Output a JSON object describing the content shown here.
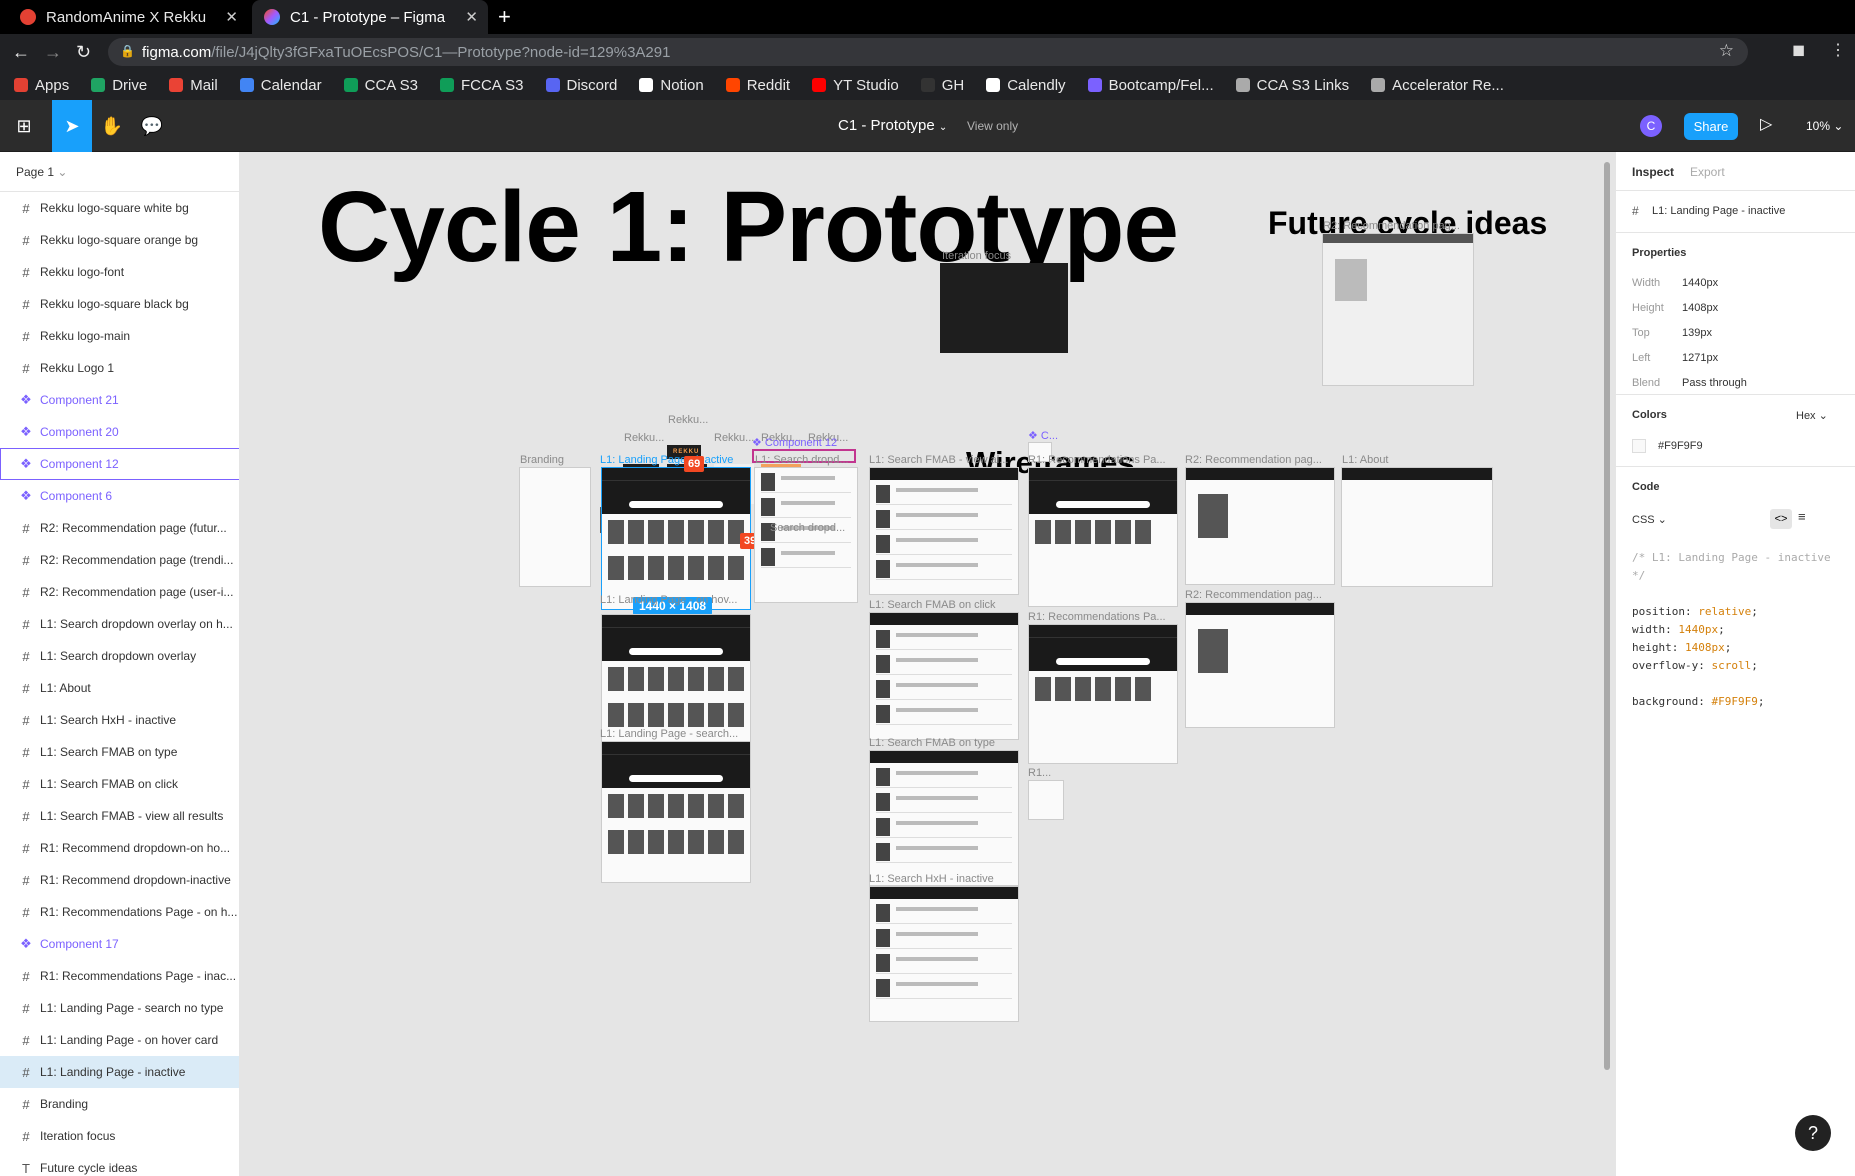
{
  "browser": {
    "tabs": [
      {
        "title": "RandomAnime X Rekku",
        "close": "✕"
      },
      {
        "title": "C1 - Prototype – Figma",
        "close": "✕"
      }
    ],
    "new_tab": "+",
    "url_host": "figma.com",
    "url_path": "/file/J4jQlty3fGFxaTuOEcsPOS/C1—Prototype?node-id=129%3A291",
    "bookmarks": [
      {
        "label": "Apps",
        "color": "#e34133"
      },
      {
        "label": "Drive",
        "color": "#1fa463"
      },
      {
        "label": "Mail",
        "color": "#ea4335"
      },
      {
        "label": "Calendar",
        "color": "#4285f4"
      },
      {
        "label": "CCA S3",
        "color": "#0f9d58"
      },
      {
        "label": "FCCA S3",
        "color": "#0f9d58"
      },
      {
        "label": "Discord",
        "color": "#5865f2"
      },
      {
        "label": "Notion",
        "color": "#ffffff"
      },
      {
        "label": "Reddit",
        "color": "#ff4500"
      },
      {
        "label": "YT Studio",
        "color": "#ff0000"
      },
      {
        "label": "GH",
        "color": "#333333"
      },
      {
        "label": "Calendly",
        "color": "#ffffff"
      },
      {
        "label": "Bootcamp/Fel...",
        "color": "#7b61ff"
      },
      {
        "label": "CCA S3 Links",
        "color": "#aaaaaa"
      },
      {
        "label": "Accelerator Re...",
        "color": "#aaaaaa"
      }
    ]
  },
  "figma": {
    "file_title": "C1 - Prototype",
    "view_mode": "View only",
    "avatar_letter": "C",
    "share_label": "Share",
    "zoom": "10%",
    "page_selector": "Page 1",
    "layers": [
      {
        "name": "Rekku logo-square white bg",
        "type": "frame"
      },
      {
        "name": "Rekku logo-square orange bg",
        "type": "frame"
      },
      {
        "name": "Rekku logo-font",
        "type": "frame"
      },
      {
        "name": "Rekku logo-square black bg",
        "type": "frame"
      },
      {
        "name": "Rekku logo-main",
        "type": "frame"
      },
      {
        "name": "Rekku Logo 1",
        "type": "frame"
      },
      {
        "name": "Component 21",
        "type": "component"
      },
      {
        "name": "Component 20",
        "type": "component"
      },
      {
        "name": "Component 12",
        "type": "component"
      },
      {
        "name": "Component 6",
        "type": "component"
      },
      {
        "name": "R2: Recommendation page (futur...",
        "type": "frame"
      },
      {
        "name": "R2: Recommendation page (trendi...",
        "type": "frame"
      },
      {
        "name": "R2: Recommendation page (user-i...",
        "type": "frame"
      },
      {
        "name": "L1: Search dropdown overlay on h...",
        "type": "frame"
      },
      {
        "name": "L1: Search dropdown overlay",
        "type": "frame"
      },
      {
        "name": "L1: About",
        "type": "frame"
      },
      {
        "name": "L1: Search HxH - inactive",
        "type": "frame"
      },
      {
        "name": "L1: Search FMAB on type",
        "type": "frame"
      },
      {
        "name": "L1: Search FMAB on click",
        "type": "frame"
      },
      {
        "name": "L1: Search FMAB - view all results",
        "type": "frame"
      },
      {
        "name": "R1: Recommend dropdown-on ho...",
        "type": "frame"
      },
      {
        "name": "R1: Recommend dropdown-inactive",
        "type": "frame"
      },
      {
        "name": "R1: Recommendations Page - on h...",
        "type": "frame"
      },
      {
        "name": "Component 17",
        "type": "component"
      },
      {
        "name": "R1: Recommendations Page - inac...",
        "type": "frame"
      },
      {
        "name": "L1: Landing Page - search no type",
        "type": "frame"
      },
      {
        "name": "L1: Landing Page - on hover card",
        "type": "frame"
      },
      {
        "name": "L1: Landing Page - inactive",
        "type": "frame"
      },
      {
        "name": "Branding",
        "type": "frame"
      },
      {
        "name": "Iteration focus",
        "type": "frame"
      },
      {
        "name": "Future cycle ideas",
        "type": "text"
      }
    ],
    "canvas": {
      "main_title": "Cycle 1: Prototype",
      "future_title": "Future cycle ideas",
      "wireframes_title": "Wireframes",
      "labels": {
        "iteration_focus": "Iteration focus",
        "r2_future": "R2: Recommendation pag...",
        "branding": "Branding",
        "landing_inactive": "L1: Landing Page - inactive",
        "component12": "Component 12",
        "search_dropdown": "L1: Search dropd...",
        "search_dropdown_overlay": "Search dropd...",
        "fmab_view_all": "L1: Search FMAB - view al...",
        "r1_recs": "R1: Recommendations Pa...",
        "r2_rec": "R2: Recommendation pag...",
        "about": "L1: About",
        "landing_hover": "L1: Landing Page - on hov...",
        "fmab_click": "L1: Search FMAB on click",
        "r1_recs2": "R1: Recommendations Pa...",
        "r2_rec2": "R2: Recommendation pag...",
        "landing_search": "L1: Landing Page - search...",
        "fmab_type": "L1: Search FMAB on type",
        "hxh_inactive": "L1: Search HxH - inactive",
        "rekku": "Rekku...",
        "comp_c": "C...",
        "r1_small": "R1..."
      },
      "logo_word": "REKKU",
      "badge_69": "69",
      "badge_39": "39",
      "dimension_badge": "1440 × 1408"
    },
    "inspect": {
      "tab_inspect": "Inspect",
      "tab_export": "Export",
      "selected_name": "L1: Landing Page - inactive",
      "properties_title": "Properties",
      "props": [
        {
          "key": "Width",
          "value": "1440px"
        },
        {
          "key": "Height",
          "value": "1408px"
        },
        {
          "key": "Top",
          "value": "139px"
        },
        {
          "key": "Left",
          "value": "1271px"
        },
        {
          "key": "Blend",
          "value": "Pass through"
        }
      ],
      "colors_title": "Colors",
      "color_format": "Hex",
      "color_value": "#F9F9F9",
      "code_title": "Code",
      "code_lang": "CSS",
      "code_comment1": "/* L1: Landing Page - inactive",
      "code_comment2": "*/",
      "code_lines": [
        {
          "prop": "position: ",
          "val": "relative",
          "end": ";"
        },
        {
          "prop": "width: ",
          "val": "1440px",
          "end": ";"
        },
        {
          "prop": "height: ",
          "val": "1408px",
          "end": ";"
        },
        {
          "prop": "overflow-y: ",
          "val": "scroll",
          "end": ";"
        }
      ],
      "code_bg_prop": "background: ",
      "code_bg_val": "#F9F9F9",
      "code_bg_end": ";"
    },
    "help": "?"
  }
}
